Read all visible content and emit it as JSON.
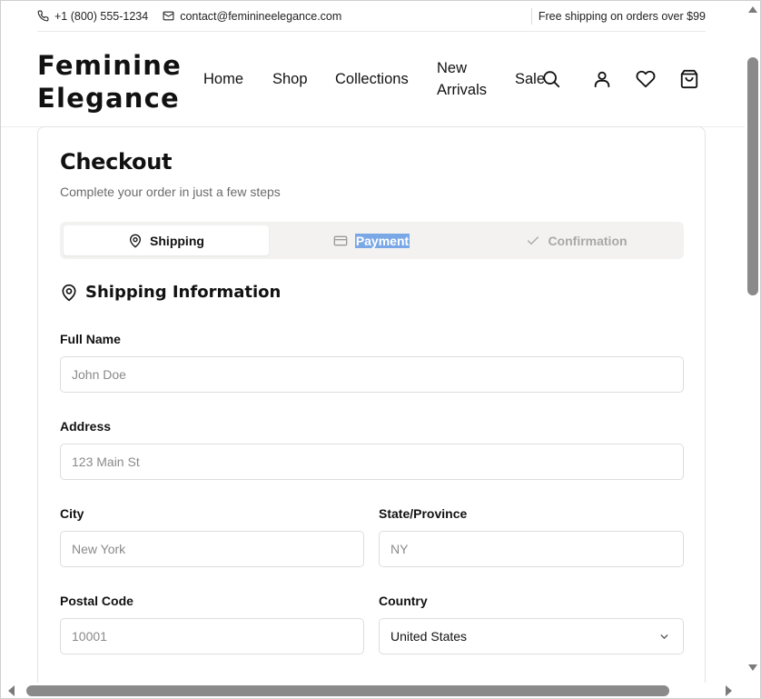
{
  "topbar": {
    "phone": "+1 (800) 555-1234",
    "email": "contact@feminineelegance.com",
    "promo": "Free shipping on orders over $99"
  },
  "header": {
    "logo_line1": "Feminine",
    "logo_line2": "Elegance",
    "nav": {
      "home": "Home",
      "shop": "Shop",
      "collections": "Collections",
      "new_line1": "New",
      "new_line2": "Arrivals",
      "sale": "Sale"
    },
    "icons": [
      "search-icon",
      "user-icon",
      "heart-icon",
      "shopping-bag-icon"
    ]
  },
  "checkout": {
    "title": "Checkout",
    "subtitle": "Complete your order in just a few steps",
    "steps": {
      "shipping": "Shipping",
      "payment": "Payment",
      "confirmation": "Confirmation"
    },
    "active_step": "Shipping",
    "section_title": "Shipping Information",
    "fields": {
      "full_name": {
        "label": "Full Name",
        "placeholder": "John Doe"
      },
      "address": {
        "label": "Address",
        "placeholder": "123 Main St"
      },
      "city": {
        "label": "City",
        "placeholder": "New York"
      },
      "state": {
        "label": "State/Province",
        "placeholder": "NY"
      },
      "postal": {
        "label": "Postal Code",
        "placeholder": "10001"
      },
      "country": {
        "label": "Country",
        "value": "United States"
      }
    }
  },
  "colors": {
    "text": "#111111",
    "muted": "#6b6b6b",
    "step_bg": "#f3f2f0",
    "selection": "#7aa8e6"
  }
}
